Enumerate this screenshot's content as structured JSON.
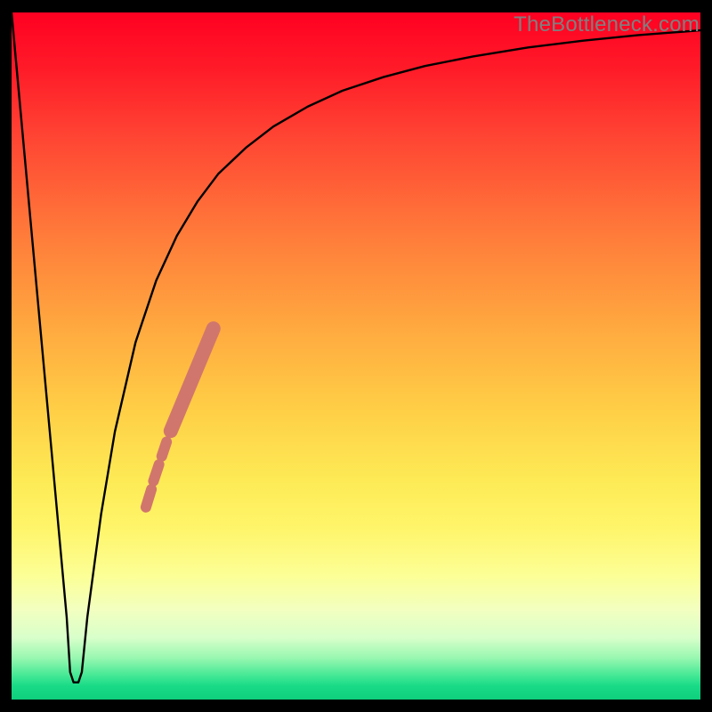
{
  "watermark": "TheBottleneck.com",
  "chart_data": {
    "type": "line",
    "title": "",
    "xlabel": "",
    "ylabel": "",
    "xlim": [
      0,
      100
    ],
    "ylim": [
      0,
      100
    ],
    "note": "Bottleneck curve. Y-axis = bottleneck severity (0 = green/good at bottom, 100 = red/bad at top). X-axis = relative component performance. Sharp V-notch near x≈9 where bottleneck drops to ~0, then asymptotically climbs toward ~100.",
    "series": [
      {
        "name": "bottleneck-curve",
        "x": [
          0,
          4,
          7,
          8,
          8.5,
          9,
          9.7,
          10.2,
          11,
          13,
          15,
          18,
          21,
          24,
          27,
          30,
          34,
          38,
          43,
          48,
          54,
          60,
          67,
          75,
          83,
          91,
          100
        ],
        "y": [
          100,
          56,
          23,
          12,
          4,
          2.5,
          2.5,
          4,
          12,
          27,
          39,
          52,
          61,
          67.5,
          72.5,
          76.5,
          80.3,
          83.4,
          86.3,
          88.6,
          90.6,
          92.2,
          93.6,
          94.9,
          95.9,
          96.7,
          97.4
        ]
      }
    ],
    "markers": {
      "name": "highlight-band",
      "color": "#d1766c",
      "segments": [
        {
          "x0": 19.5,
          "y0": 28.0,
          "x1": 20.3,
          "y1": 30.6,
          "r": 6
        },
        {
          "x0": 20.6,
          "y0": 31.8,
          "x1": 21.4,
          "y1": 34.2,
          "r": 6
        },
        {
          "x0": 21.8,
          "y0": 35.4,
          "x1": 22.5,
          "y1": 37.5,
          "r": 6
        },
        {
          "x0": 23.1,
          "y0": 39.1,
          "x1": 29.3,
          "y1": 54.0,
          "r": 8
        }
      ]
    },
    "background_gradient": {
      "stops": [
        {
          "pos": 0.0,
          "color": "#ff0022"
        },
        {
          "pos": 0.32,
          "color": "#ff7a3a"
        },
        {
          "pos": 0.58,
          "color": "#ffcf46"
        },
        {
          "pos": 0.82,
          "color": "#fcff96"
        },
        {
          "pos": 0.96,
          "color": "#44e895"
        },
        {
          "pos": 1.0,
          "color": "#0fcf7d"
        }
      ]
    }
  }
}
